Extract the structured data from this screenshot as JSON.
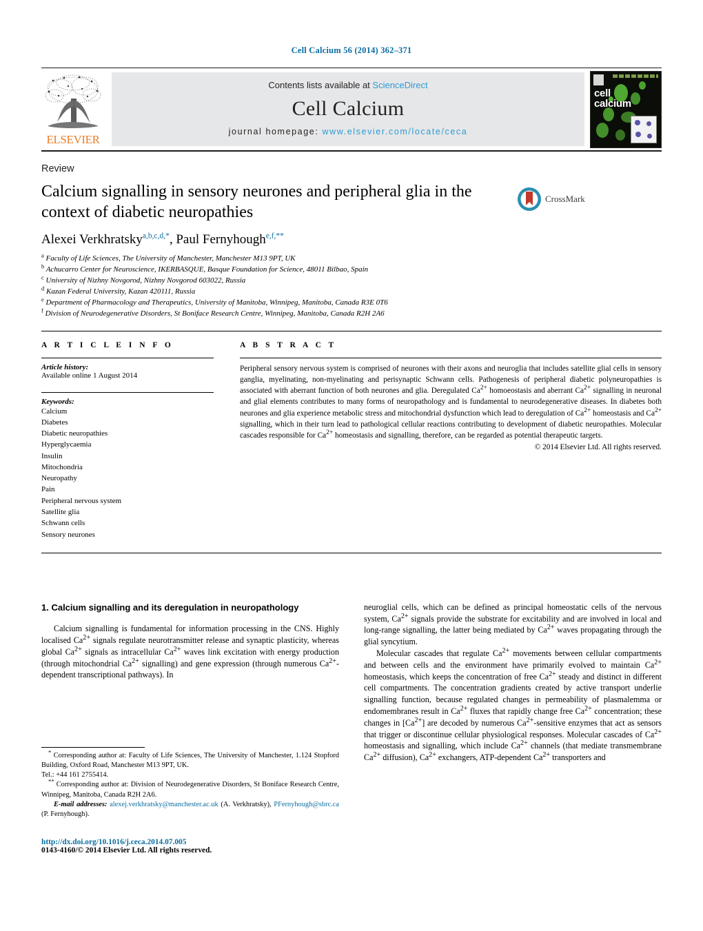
{
  "running_head": "Cell Calcium 56 (2014) 362–371",
  "banner": {
    "publisher_wordmark": "ELSEVIER",
    "contents_prefix": "Contents lists available at ",
    "contents_link": "ScienceDirect",
    "journal_title": "Cell Calcium",
    "homepage_prefix": "journal homepage: ",
    "homepage_url": "www.elsevier.com/locate/ceca",
    "cover_line1": "cell",
    "cover_line2": "calcium",
    "link_color": "#2e9bd6"
  },
  "article": {
    "doc_type": "Review",
    "title": "Calcium signalling in sensory neurones and peripheral glia in the context of diabetic neuropathies",
    "crossmark_label": "CrossMark",
    "authors_html": "Alexei Verkhratsky<sup>a,b,c,d,</sup><sup>*</sup>, Paul Fernyhough<sup>e,f,</sup><sup>**</sup>",
    "affiliations": [
      {
        "mark": "a",
        "text": "Faculty of Life Sciences, The University of Manchester, Manchester M13 9PT, UK"
      },
      {
        "mark": "b",
        "text": "Achucarro Center for Neuroscience, IKERBASQUE, Basque Foundation for Science, 48011 Bilbao, Spain"
      },
      {
        "mark": "c",
        "text": "University of Nizhny Novgorod, Nizhny Novgorod 603022, Russia"
      },
      {
        "mark": "d",
        "text": "Kazan Federal University, Kazan 420111, Russia"
      },
      {
        "mark": "e",
        "text": "Department of Pharmacology and Therapeutics, University of Manitoba, Winnipeg, Manitoba, Canada R3E 0T6"
      },
      {
        "mark": "f",
        "text": "Division of Neurodegenerative Disorders, St Boniface Research Centre, Winnipeg, Manitoba, Canada R2H 2A6"
      }
    ]
  },
  "info": {
    "heading": "A R T I C L E   I N F O",
    "history_label": "Article history:",
    "history_value": "Available online 1 August 2014",
    "keywords_label": "Keywords:",
    "keywords": [
      "Calcium",
      "Diabetes",
      "Diabetic neuropathies",
      "Hyperglycaemia",
      "Insulin",
      "Mitochondria",
      "Neuropathy",
      "Pain",
      "Peripheral nervous system",
      "Satellite glia",
      "Schwann cells",
      "Sensory neurones"
    ]
  },
  "abstract": {
    "heading": "A B S T R A C T",
    "body_html": "Peripheral sensory nervous system is comprised of neurones with their axons and neuroglia that includes satellite glial cells in sensory ganglia, myelinating, non-myelinating and perisynaptic Schwann cells. Pathogenesis of peripheral diabetic polyneuropathies is associated with aberrant function of both neurones and glia. Deregulated Ca<sup>2+</sup> homoeostasis and aberrant Ca<sup>2+</sup> signalling in neuronal and glial elements contributes to many forms of neuropathology and is fundamental to neurodegenerative diseases. In diabetes both neurones and glia experience metabolic stress and mitochondrial dysfunction which lead to deregulation of Ca<sup>2+</sup> homeostasis and Ca<sup>2+</sup> signalling, which in their turn lead to pathological cellular reactions contributing to development of diabetic neuropathies. Molecular cascades responsible for Ca<sup>2+</sup> homeostasis and signalling, therefore, can be regarded as potential therapeutic targets.",
    "copyright": "© 2014 Elsevier Ltd. All rights reserved."
  },
  "body": {
    "section_heading": "1.  Calcium signalling and its deregulation in neuropathology",
    "left_paragraph_html": "Calcium signalling is fundamental for information processing in the CNS. Highly localised Ca<sup>2+</sup> signals regulate neurotransmitter release and synaptic plasticity, whereas global Ca<sup>2+</sup> signals as intracellular Ca<sup>2+</sup> waves link excitation with energy production (through mitochondrial Ca<sup>2+</sup> signalling) and gene expression (through numerous Ca<sup>2+</sup>-dependent transcriptional pathways). In",
    "right_paragraph1_html": "neuroglial cells, which can be defined as principal homeostatic cells of the nervous system, Ca<sup>2+</sup> signals provide the substrate for excitability and are involved in local and long-range signalling, the latter being mediated by Ca<sup>2+</sup> waves propagating through the glial syncytium.",
    "right_paragraph2_html": "Molecular cascades that regulate Ca<sup>2+</sup> movements between cellular compartments and between cells and the environment have primarily evolved to maintain Ca<sup>2+</sup> homeostasis, which keeps the concentration of free Ca<sup>2+</sup> steady and distinct in different cell compartments. The concentration gradients created by active transport underlie signalling function, because regulated changes in permeability of plasmalemma or endomembranes result in Ca<sup>2+</sup> fluxes that rapidly change free Ca<sup>2+</sup> concentration; these changes in [Ca<sup>2+</sup>] are decoded by numerous Ca<sup>2+</sup>-sensitive enzymes that act as sensors that trigger or discontinue cellular physiological responses. Molecular cascades of Ca<sup>2+</sup> homeostasis and signalling, which include Ca<sup>2+</sup> channels (that mediate transmembrane Ca<sup>2+</sup> diffusion), Ca<sup>2+</sup> exchangers, ATP-dependent Ca<sup>2+</sup> transporters and"
  },
  "footnotes": {
    "corresponding1_html": "<sup>*</sup> Corresponding author at: Faculty of Life Sciences, The University of Manchester, 1.124 Stopford Building, Oxford Road, Manchester M13 9PT, UK.",
    "tel_line": "Tel.: +44 161 2755414.",
    "corresponding2_html": "<sup>**</sup> Corresponding author at: Division of Neurodegenerative Disorders, St Boniface Research Centre, Winnipeg, Manitoba, Canada R2H 2A6.",
    "email_label": "E-mail addresses:",
    "email1": "alexej.verkhratsky@manchester.ac.uk",
    "email1_owner": "(A. Verkhratsky),",
    "email2": "PFernyhough@sbrc.ca",
    "email2_owner": "(P. Fernyhough).",
    "doi": "http://dx.doi.org/10.1016/j.ceca.2014.07.005",
    "issn_line": "0143-4160/© 2014 Elsevier Ltd. All rights reserved."
  }
}
